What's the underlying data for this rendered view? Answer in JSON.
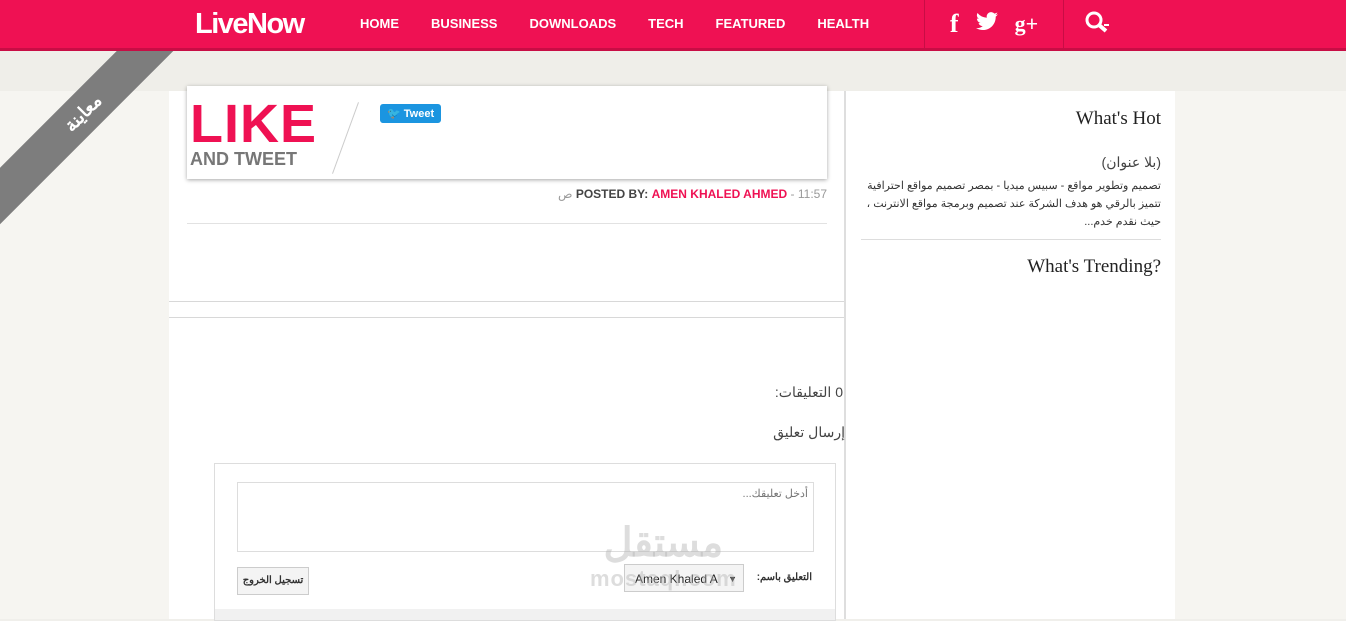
{
  "header": {
    "logo": "LiveNow",
    "nav": [
      "HOME",
      "BUSINESS",
      "DOWNLOADS",
      "TECH",
      "FEATURED",
      "HEALTH"
    ],
    "social": [
      {
        "name": "facebook-icon",
        "glyph": "f"
      },
      {
        "name": "twitter-icon",
        "glyph": "🐦"
      },
      {
        "name": "google-plus-icon",
        "glyph": "g+"
      }
    ],
    "colors": {
      "brand": "#ef1153",
      "brand_dark": "#c80d45"
    }
  },
  "ribbon": "معاينة",
  "post": {
    "banner_big": "LIKE",
    "banner_small": "AND TWEET",
    "tweet_label": "Tweet",
    "time": "11:57",
    "meridiem": "ص",
    "posted_by_label": "POSTED BY:",
    "author": "AMEN KHALED AHMED"
  },
  "comments": {
    "count_label": "0 التعليقات:",
    "send_label": "إرسال تعليق",
    "placeholder": "أدخل تعليقك...",
    "comment_as_label": "التعليق باسم:",
    "identity": "Amen Khaled A",
    "logout_label": "تسجيل الخروج"
  },
  "sidebar": {
    "hot_title": "What's Hot",
    "hot_post_title": "(بلا عنوان)",
    "hot_post_snippet": "تصميم وتطوير مواقع - سبيس ميديا - بمصر تصميم مواقع احترافية تتميز بالرقي هو هدف الشركة عند تصميم وبرمجة مواقع الانترنت ، حيث نقدم خدم...",
    "trending_title": "What's Trending?"
  },
  "watermark": {
    "arabic": "مستقل",
    "latin": "mostaql.com"
  }
}
